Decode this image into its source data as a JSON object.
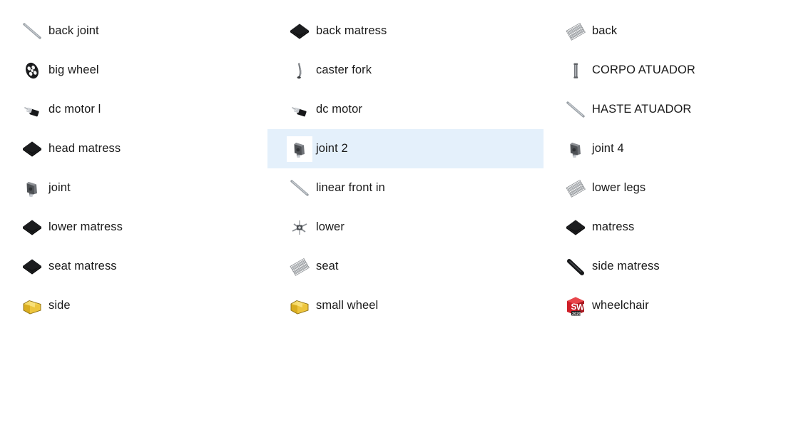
{
  "view": {
    "background_color": "#ffffff",
    "selection_color": "#e4f0fb",
    "text_color": "#1a1a1a",
    "layout": "three-column-list"
  },
  "columns": [
    {
      "items": [
        {
          "label": "back joint",
          "icon": "solidworks-rod-part-icon",
          "selected": false
        },
        {
          "label": "big wheel",
          "icon": "solidworks-wheel-part-icon",
          "selected": false
        },
        {
          "label": "dc motor l",
          "icon": "solidworks-motor-part-icon",
          "selected": false
        },
        {
          "label": "head matress",
          "icon": "solidworks-slab-part-icon",
          "selected": false
        },
        {
          "label": "joint",
          "icon": "solidworks-joint-part-icon",
          "selected": false
        },
        {
          "label": "lower matress",
          "icon": "solidworks-slab-part-icon",
          "selected": false
        },
        {
          "label": "seat matress",
          "icon": "solidworks-slab-part-icon",
          "selected": false
        },
        {
          "label": "side",
          "icon": "solidworks-part-file-icon",
          "selected": false
        }
      ]
    },
    {
      "items": [
        {
          "label": "back matress",
          "icon": "solidworks-slab-part-icon",
          "selected": false
        },
        {
          "label": "caster fork",
          "icon": "solidworks-fork-part-icon",
          "selected": false
        },
        {
          "label": "dc motor",
          "icon": "solidworks-motor-part-icon",
          "selected": false
        },
        {
          "label": "joint 2",
          "icon": "solidworks-joint-part-icon",
          "selected": true
        },
        {
          "label": "linear front in",
          "icon": "solidworks-rod-part-icon",
          "selected": false
        },
        {
          "label": "lower",
          "icon": "solidworks-assembly-part-icon",
          "selected": false
        },
        {
          "label": "seat",
          "icon": "solidworks-frame-part-icon",
          "selected": false
        },
        {
          "label": "small wheel",
          "icon": "solidworks-part-file-icon",
          "selected": false
        }
      ]
    },
    {
      "items": [
        {
          "label": "back",
          "icon": "solidworks-frame-part-icon",
          "selected": false
        },
        {
          "label": "CORPO ATUADOR",
          "icon": "solidworks-cylinder-part-icon",
          "selected": false
        },
        {
          "label": "HASTE ATUADOR",
          "icon": "solidworks-rod-part-icon",
          "selected": false
        },
        {
          "label": "joint 4",
          "icon": "solidworks-joint-part-icon",
          "selected": false
        },
        {
          "label": "lower legs",
          "icon": "solidworks-frame-part-icon",
          "selected": false
        },
        {
          "label": "matress",
          "icon": "solidworks-slab-part-icon",
          "selected": false
        },
        {
          "label": "side matress",
          "icon": "solidworks-bar-part-icon",
          "selected": false
        },
        {
          "label": "wheelchair",
          "icon": "solidworks-2020-app-icon",
          "selected": false
        }
      ]
    }
  ]
}
